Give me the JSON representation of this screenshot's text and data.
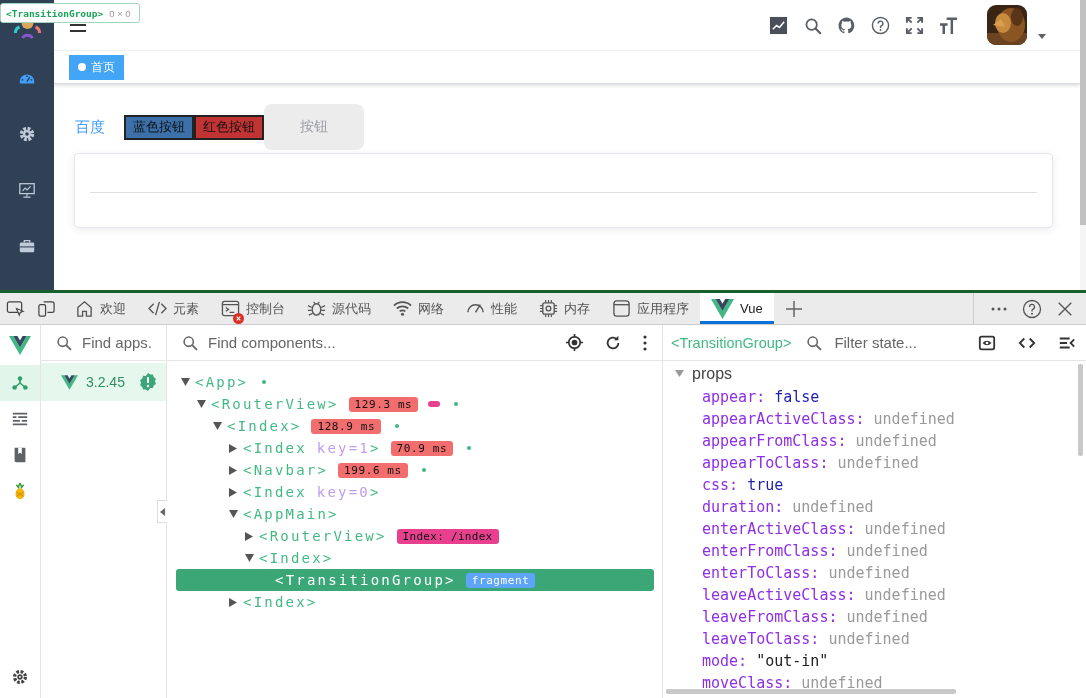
{
  "tooltip": {
    "component": "<TransitionGroup>",
    "size": "0 × 0"
  },
  "app": {
    "sidebar": {
      "items": [
        {
          "kind": "dashboard",
          "selected": true
        },
        {
          "kind": "gear",
          "selected": false
        },
        {
          "kind": "monitor",
          "selected": false
        },
        {
          "kind": "toolbox",
          "selected": false
        }
      ]
    },
    "tags": [
      {
        "label": "首页",
        "selected": true
      }
    ],
    "link": "百度",
    "buttons": [
      {
        "label": "蓝色按钮",
        "kind": "blue"
      },
      {
        "label": "红色按钮",
        "kind": "red"
      },
      {
        "label": "按钮",
        "kind": "plain"
      }
    ]
  },
  "devtools": {
    "tabs": [
      {
        "label": "欢迎",
        "kind": "home",
        "selected": false,
        "has_error": false
      },
      {
        "label": "元素",
        "kind": "code",
        "selected": false,
        "has_error": false
      },
      {
        "label": "控制台",
        "kind": "console",
        "selected": false,
        "has_error": true
      },
      {
        "label": "源代码",
        "kind": "bug",
        "selected": false,
        "has_error": false
      },
      {
        "label": "网络",
        "kind": "wifi",
        "selected": false,
        "has_error": false
      },
      {
        "label": "性能",
        "kind": "gauge",
        "selected": false,
        "has_error": false
      },
      {
        "label": "内存",
        "kind": "chip",
        "selected": false,
        "has_error": false
      },
      {
        "label": "应用程序",
        "kind": "window",
        "selected": false,
        "has_error": false
      },
      {
        "label": "Vue",
        "kind": "vue",
        "selected": true,
        "has_error": false
      }
    ]
  },
  "vue": {
    "rail": [
      {
        "kind": "tree",
        "selected": true
      },
      {
        "kind": "timeline",
        "selected": false
      },
      {
        "kind": "book",
        "selected": false
      },
      {
        "kind": "pineapple",
        "selected": false
      }
    ],
    "apps_search": {
      "placeholder": "Find apps."
    },
    "apps": [
      {
        "version": "3.2.45",
        "selected": true
      }
    ],
    "components_search": {
      "placeholder": "Find components..."
    },
    "tree": [
      {
        "name": "<App>",
        "kind": "branch",
        "expanded": true,
        "selected": false,
        "indicators": [
          {
            "kind": "dot",
            "color": "#42b983"
          }
        ],
        "children": [
          {
            "name": "<RouterView>",
            "kind": "branch",
            "expanded": true,
            "selected": false,
            "badges": [
              {
                "text": "129.3 ms",
                "kind": "timing",
                "color": "#f26d6d"
              }
            ],
            "indicators": [
              {
                "kind": "pill",
                "color": "#e8408f"
              },
              {
                "kind": "dot",
                "color": "#42b983"
              }
            ],
            "children": [
              {
                "name": "<Index>",
                "kind": "branch",
                "expanded": true,
                "selected": false,
                "badges": [
                  {
                    "text": "128.9 ms",
                    "kind": "timing",
                    "color": "#f26d6d"
                  }
                ],
                "indicators": [
                  {
                    "kind": "dot",
                    "color": "#42b983"
                  }
                ],
                "children": [
                  {
                    "name": "<Index",
                    "key": "key=1",
                    "close": ">",
                    "kind": "branch",
                    "expanded": false,
                    "selected": false,
                    "badges": [
                      {
                        "text": "70.9 ms",
                        "kind": "timing",
                        "color": "#f26d6d"
                      }
                    ],
                    "indicators": [
                      {
                        "kind": "dot",
                        "color": "#42b983"
                      }
                    ]
                  },
                  {
                    "name": "<Navbar>",
                    "kind": "branch",
                    "expanded": false,
                    "selected": false,
                    "badges": [
                      {
                        "text": "199.6 ms",
                        "kind": "timing",
                        "color": "#f26d6d"
                      }
                    ],
                    "indicators": [
                      {
                        "kind": "dot",
                        "color": "#42b983"
                      }
                    ]
                  },
                  {
                    "name": "<Index",
                    "key": "key=0",
                    "close": ">",
                    "kind": "branch",
                    "expanded": false,
                    "selected": false
                  },
                  {
                    "name": "<AppMain>",
                    "kind": "branch",
                    "expanded": true,
                    "selected": false,
                    "children": [
                      {
                        "name": "<RouterView>",
                        "kind": "branch",
                        "expanded": false,
                        "selected": false,
                        "badges": [
                          {
                            "text": "Index: /index",
                            "kind": "route",
                            "color": "#e8408f"
                          }
                        ]
                      },
                      {
                        "name": "<Index>",
                        "kind": "branch",
                        "expanded": true,
                        "selected": false,
                        "children": [
                          {
                            "name": "<TransitionGroup>",
                            "kind": "leaf",
                            "selected": true,
                            "badges": [
                              {
                                "text": "fragment",
                                "kind": "fragment",
                                "color": "#5ea4f7"
                              }
                            ]
                          }
                        ]
                      }
                    ]
                  },
                  {
                    "name": "<Index>",
                    "kind": "branch",
                    "expanded": false,
                    "selected": false
                  }
                ]
              }
            ]
          }
        ]
      }
    ],
    "inspector": {
      "component": "<TransitionGroup>",
      "filter": {
        "placeholder": "Filter state..."
      },
      "section": {
        "title": "props",
        "expanded": true,
        "props": [
          {
            "key": "appear:",
            "value": "false",
            "kind": "literal"
          },
          {
            "key": "appearActiveClass:",
            "value": "undefined",
            "kind": "undefined"
          },
          {
            "key": "appearFromClass:",
            "value": "undefined",
            "kind": "undefined"
          },
          {
            "key": "appearToClass:",
            "value": "undefined",
            "kind": "undefined"
          },
          {
            "key": "css:",
            "value": "true",
            "kind": "literal"
          },
          {
            "key": "duration:",
            "value": "undefined",
            "kind": "undefined"
          },
          {
            "key": "enterActiveClass:",
            "value": "undefined",
            "kind": "undefined"
          },
          {
            "key": "enterFromClass:",
            "value": "undefined",
            "kind": "undefined"
          },
          {
            "key": "enterToClass:",
            "value": "undefined",
            "kind": "undefined"
          },
          {
            "key": "leaveActiveClass:",
            "value": "undefined",
            "kind": "undefined"
          },
          {
            "key": "leaveFromClass:",
            "value": "undefined",
            "kind": "undefined"
          },
          {
            "key": "leaveToClass:",
            "value": "undefined",
            "kind": "undefined"
          },
          {
            "key": "mode:",
            "value": "\"out-in\"",
            "kind": "string"
          },
          {
            "key": "moveClass:",
            "value": "undefined",
            "kind": "undefined"
          }
        ]
      }
    }
  }
}
